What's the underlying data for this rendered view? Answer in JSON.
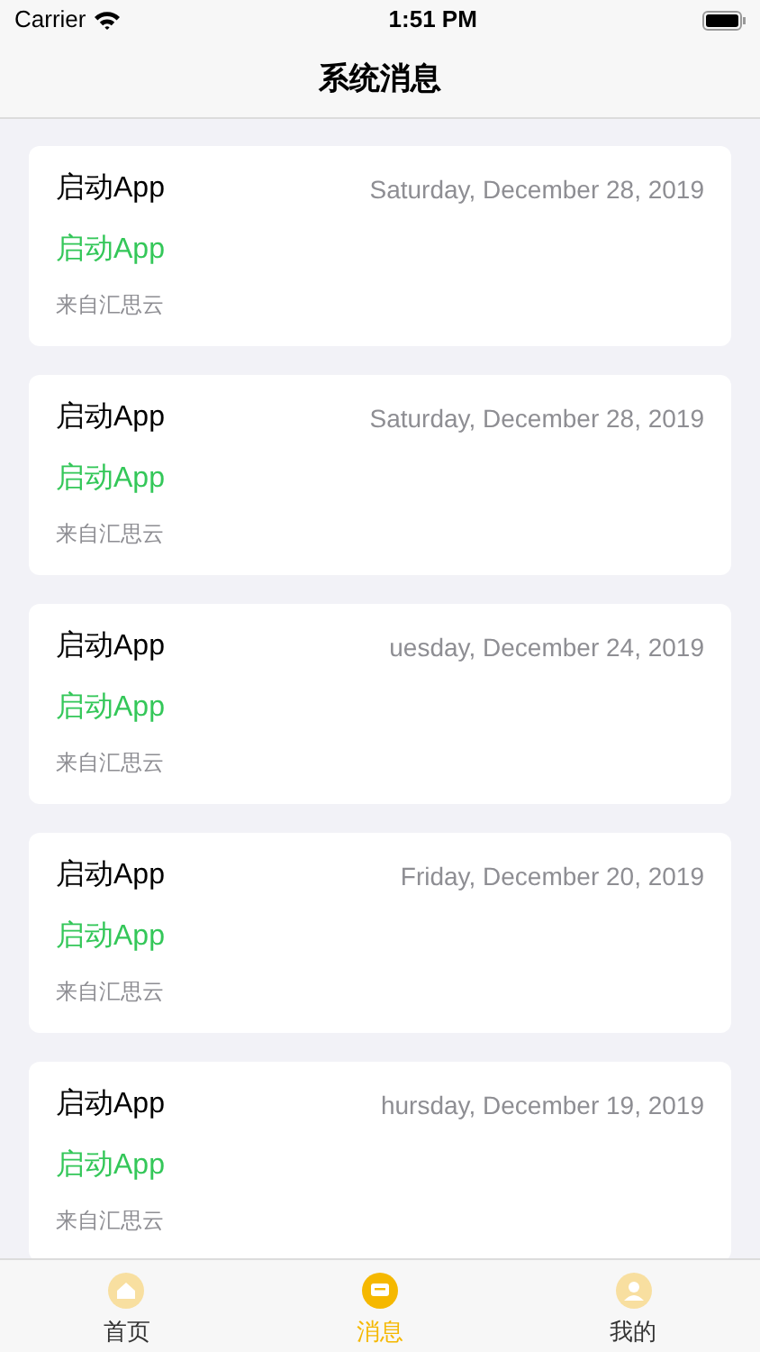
{
  "status_bar": {
    "carrier": "Carrier",
    "time": "1:51 PM"
  },
  "nav": {
    "title": "系统消息"
  },
  "messages": [
    {
      "title": "启动App",
      "date": "Saturday, December 28, 2019",
      "body": "启动App",
      "source": "来自汇思云"
    },
    {
      "title": "启动App",
      "date": "Saturday, December 28, 2019",
      "body": "启动App",
      "source": "来自汇思云"
    },
    {
      "title": "启动App",
      "date": "uesday, December 24, 2019",
      "body": "启动App",
      "source": "来自汇思云"
    },
    {
      "title": "启动App",
      "date": "Friday, December 20, 2019",
      "body": "启动App",
      "source": "来自汇思云"
    },
    {
      "title": "启动App",
      "date": "hursday, December 19, 2019",
      "body": "启动App",
      "source": "来自汇思云"
    }
  ],
  "tabs": [
    {
      "kind": "home",
      "label": "首页",
      "selected": false
    },
    {
      "kind": "messages",
      "label": "消息",
      "selected": true
    },
    {
      "kind": "profile",
      "label": "我的",
      "selected": false
    }
  ]
}
